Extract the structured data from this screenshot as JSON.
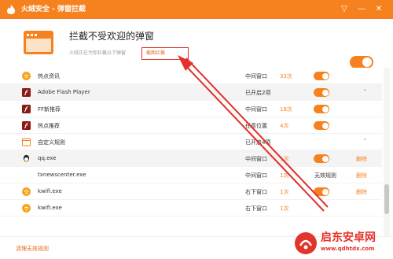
{
  "window": {
    "title": "火绒安全 - 弹窗拦截"
  },
  "header": {
    "title": "拦截不受欢迎的弹窗",
    "subtitle": "火绒正在为你拦截以下弹窗",
    "link": "截图拦截",
    "enabled": true
  },
  "rows": [
    {
      "kind": "item",
      "icon": "kwifi-icon",
      "name": "热点资讯",
      "type": "中间窗口",
      "count": "33次",
      "toggle": true,
      "action": "",
      "delete": ""
    },
    {
      "kind": "group",
      "icon": "flash-icon",
      "name": "Adobe Flash Player",
      "type": "已开启2项",
      "count": "",
      "toggle": true,
      "expanded": true
    },
    {
      "kind": "item",
      "icon": "flash-icon",
      "name": "FF新推荐",
      "type": "中间窗口",
      "count": "18次",
      "toggle": true,
      "action": "",
      "delete": ""
    },
    {
      "kind": "item",
      "icon": "flash-icon",
      "name": "热点推荐",
      "type": "任意位置",
      "count": "4次",
      "toggle": true,
      "action": "",
      "delete": ""
    },
    {
      "kind": "group",
      "icon": "custom-rule-icon",
      "name": "自定义规则",
      "type": "已开启4项",
      "count": "",
      "toggle": false,
      "expanded": true
    },
    {
      "kind": "item",
      "icon": "qq-icon",
      "name": "qq.exe",
      "type": "中间窗口",
      "count": "1次",
      "toggle": true,
      "action": "",
      "delete": "删除"
    },
    {
      "kind": "item",
      "icon": "none",
      "name": "txnewscenter.exe",
      "type": "中间窗口",
      "count": "1次",
      "toggle": false,
      "action": "无效规则",
      "delete": "删除"
    },
    {
      "kind": "item",
      "icon": "kwifi-icon",
      "name": "kwifi.exe",
      "type": "右下窗口",
      "count": "1次",
      "toggle": true,
      "action": "",
      "delete": "删除"
    },
    {
      "kind": "item",
      "icon": "kwifi-icon",
      "name": "kwifi.exe",
      "type": "右下窗口",
      "count": "1次",
      "toggle": false,
      "action": "",
      "delete": ""
    }
  ],
  "footer": {
    "link": "清理无效规则"
  },
  "watermark": {
    "text": "启东安卓网",
    "url": "www.qdhtdx.com"
  },
  "colors": {
    "accent": "#f6821f",
    "annotation": "#e3302a"
  }
}
